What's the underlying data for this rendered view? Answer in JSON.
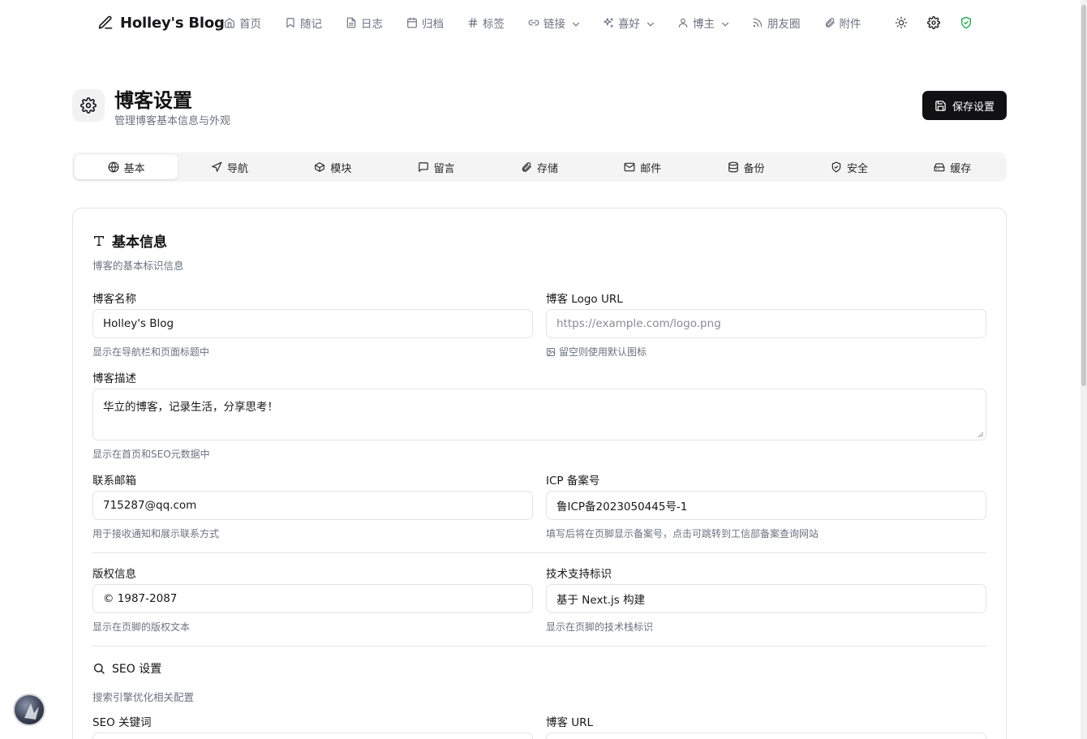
{
  "brand": {
    "name": "Holley's Blog",
    "icon": "pen-icon"
  },
  "nav": [
    {
      "label": "首页",
      "icon": "home-icon",
      "dropdown": false
    },
    {
      "label": "随记",
      "icon": "bookmark-icon",
      "dropdown": false
    },
    {
      "label": "日志",
      "icon": "file-icon",
      "dropdown": false
    },
    {
      "label": "归档",
      "icon": "calendar-icon",
      "dropdown": false
    },
    {
      "label": "标签",
      "icon": "hash-icon",
      "dropdown": false
    },
    {
      "label": "链接",
      "icon": "link-icon",
      "dropdown": true
    },
    {
      "label": "喜好",
      "icon": "sparkles-icon",
      "dropdown": true
    },
    {
      "label": "博主",
      "icon": "user-icon",
      "dropdown": true
    },
    {
      "label": "朋友圈",
      "icon": "rss-icon",
      "dropdown": false
    },
    {
      "label": "附件",
      "icon": "paperclip-icon",
      "dropdown": false
    }
  ],
  "tools": [
    {
      "name": "theme-toggle",
      "icon": "sun-icon"
    },
    {
      "name": "settings",
      "icon": "gear-icon"
    },
    {
      "name": "admin",
      "icon": "shield-check-icon"
    }
  ],
  "colors": {
    "accent": "#111113",
    "admin_shield": "#16a34a"
  },
  "header": {
    "title": "博客设置",
    "subtitle": "管理博客基本信息与外观",
    "save_label": "保存设置"
  },
  "tabs": [
    {
      "label": "基本",
      "icon": "globe-icon",
      "active": true
    },
    {
      "label": "导航",
      "icon": "navigation-icon",
      "active": false
    },
    {
      "label": "模块",
      "icon": "box-icon",
      "active": false
    },
    {
      "label": "留言",
      "icon": "message-icon",
      "active": false
    },
    {
      "label": "存储",
      "icon": "paperclip-icon",
      "active": false
    },
    {
      "label": "邮件",
      "icon": "mail-icon",
      "active": false
    },
    {
      "label": "备份",
      "icon": "database-icon",
      "active": false
    },
    {
      "label": "安全",
      "icon": "shield-check-icon",
      "active": false
    },
    {
      "label": "缓存",
      "icon": "hard-drive-icon",
      "active": false
    }
  ],
  "basic": {
    "title": "基本信息",
    "desc": "博客的基本标识信息",
    "fields": {
      "name": {
        "label": "博客名称",
        "value": "Holley's Blog",
        "help": "显示在导航栏和页面标题中"
      },
      "logo": {
        "label": "博客 Logo URL",
        "placeholder": "https://example.com/logo.png",
        "help": "留空则使用默认图标"
      },
      "description": {
        "label": "博客描述",
        "value": "华立的博客，记录生活，分享思考！",
        "help": "显示在首页和SEO元数据中"
      },
      "email": {
        "label": "联系邮箱",
        "value": "715287@qq.com",
        "help": "用于接收通知和展示联系方式"
      },
      "icp": {
        "label": "ICP 备案号",
        "value": "鲁ICP备2023050445号-1",
        "help": "填写后将在页脚显示备案号，点击可跳转到工信部备案查询网站"
      },
      "copyright": {
        "label": "版权信息",
        "value": "© 1987-2087",
        "help": "显示在页脚的版权文本"
      },
      "tech": {
        "label": "技术支持标识",
        "value": "基于 Next.js 构建",
        "help": "显示在页脚的技术栈标识"
      }
    }
  },
  "seo": {
    "title": "SEO 设置",
    "desc": "搜索引擎优化相关配置",
    "keywords_label": "SEO 关键词",
    "url_label": "博客 URL"
  }
}
